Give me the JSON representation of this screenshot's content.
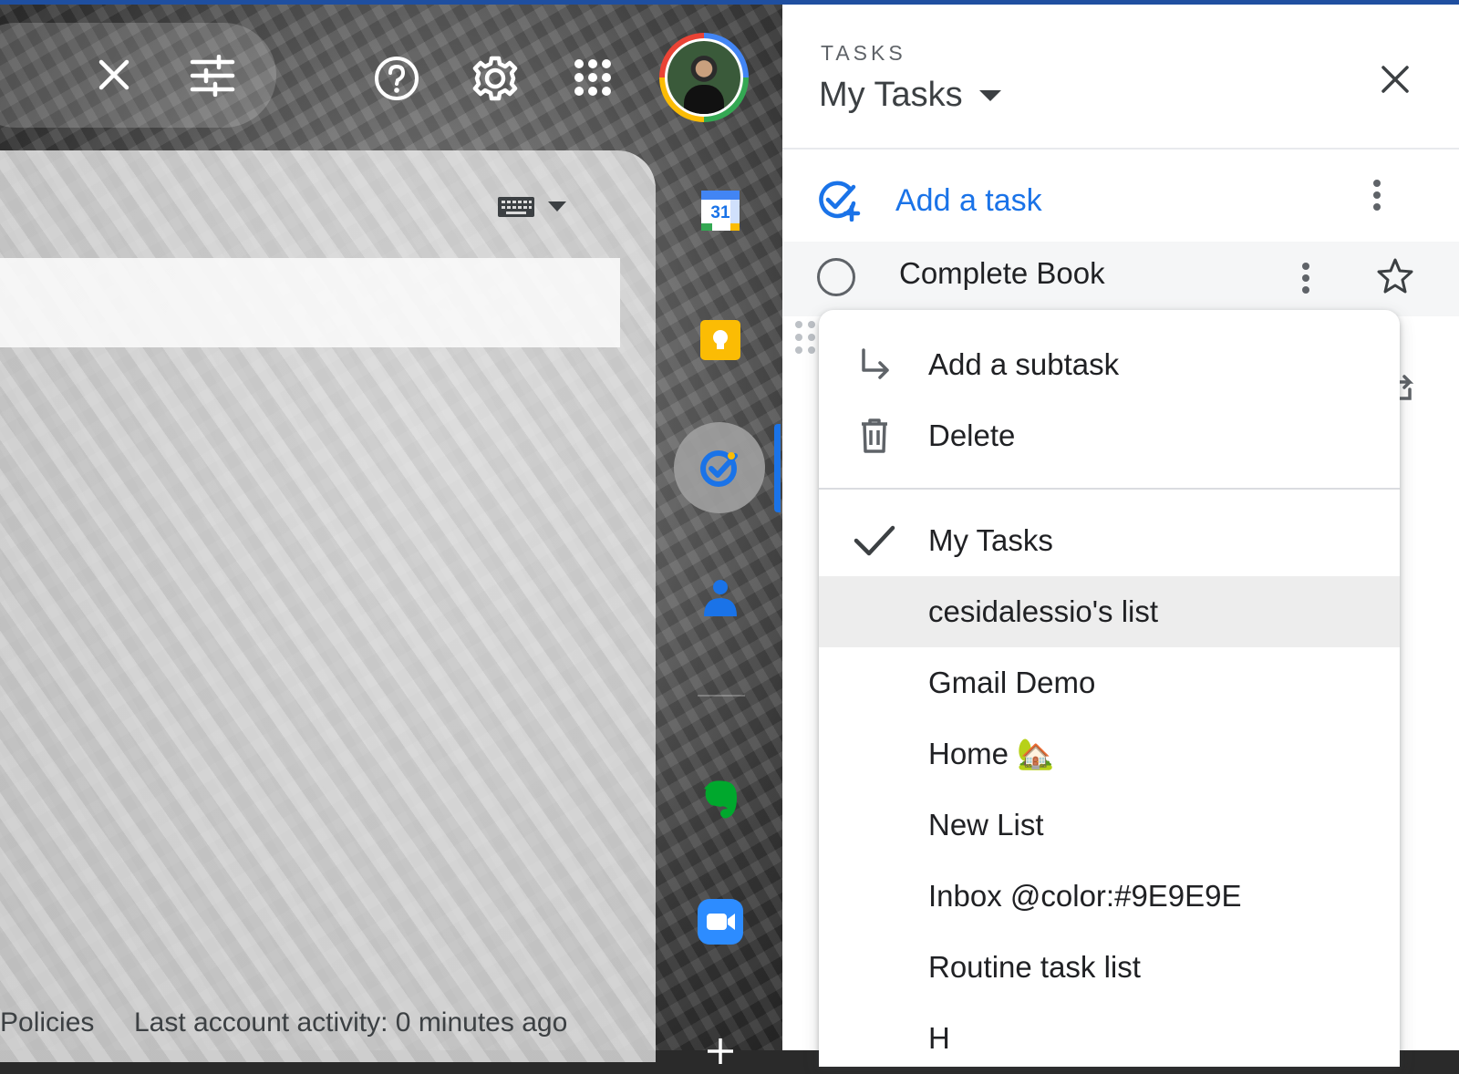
{
  "header": {
    "clear_search_icon": "close-icon",
    "search_options_icon": "tune-icon",
    "help_icon": "help-circle-icon",
    "settings_icon": "gear-icon",
    "apps_icon": "apps-grid-icon",
    "avatar_icon": "account-avatar"
  },
  "main": {
    "keyboard_icon": "keyboard-icon",
    "footer": {
      "policies": "Policies",
      "last_activity": "Last account activity: 0 minutes ago"
    }
  },
  "side_rail": {
    "items": [
      {
        "name": "calendar",
        "icon": "calendar-icon",
        "label": "31"
      },
      {
        "name": "keep",
        "icon": "keep-icon"
      },
      {
        "name": "tasks",
        "icon": "tasks-icon",
        "active": true
      },
      {
        "name": "contacts",
        "icon": "contacts-icon"
      },
      {
        "name": "evernote",
        "icon": "evernote-icon"
      },
      {
        "name": "zoom",
        "icon": "zoom-icon"
      },
      {
        "name": "add",
        "icon": "plus-icon"
      }
    ]
  },
  "tasks_panel": {
    "label": "TASKS",
    "list_title": "My Tasks",
    "add_task_label": "Add a task",
    "tasks": [
      {
        "title": "Complete Book",
        "starred": false
      }
    ]
  },
  "task_menu": {
    "actions": [
      {
        "label": "Add a subtask",
        "icon": "subtask-arrow-icon"
      },
      {
        "label": "Delete",
        "icon": "trash-icon"
      }
    ],
    "lists": [
      {
        "label": "My Tasks",
        "selected": true
      },
      {
        "label": "cesidalessio's list",
        "hovered": true
      },
      {
        "label": "Gmail Demo"
      },
      {
        "label": "Home 🏡"
      },
      {
        "label": "New List"
      },
      {
        "label": "Inbox @color:#9E9E9E"
      },
      {
        "label": "Routine task list"
      },
      {
        "label": "H"
      }
    ]
  },
  "colors": {
    "accent_blue": "#1a73e8",
    "text_dark": "#202124",
    "text_muted": "#5f6368",
    "hover_bg": "#ededed"
  }
}
